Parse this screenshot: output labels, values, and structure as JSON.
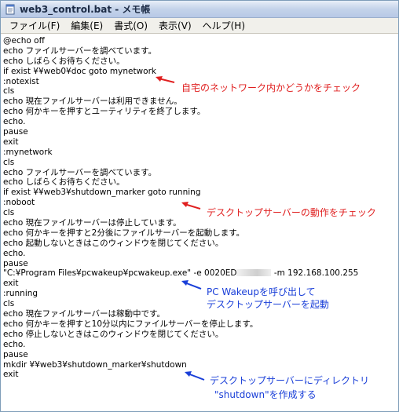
{
  "window": {
    "title": "web3_control.bat - メモ帳"
  },
  "menu": [
    "ファイル(F)",
    "編集(E)",
    "書式(O)",
    "表示(V)",
    "ヘルプ(H)"
  ],
  "code_lines": [
    "@echo off",
    "echo ファイルサーバーを調べています。",
    "echo しばらくお待ちください。",
    "if exist ¥¥web0¥doc goto mynetwork",
    ":notexist",
    "cls",
    "echo 現在ファイルサーバーは利用できません。",
    "echo 何かキーを押すとユーティリティを終了します。",
    "echo.",
    "pause",
    "exit",
    ":mynetwork",
    "cls",
    "echo ファイルサーバーを調べています。",
    "echo しばらくお待ちください。",
    "if exist ¥¥web3¥shutdown_marker goto running",
    ":noboot",
    "cls",
    "echo 現在ファイルサーバーは停止しています。",
    "echo 何かキーを押すと2分後にファイルサーバーを起動します。",
    "echo 起動しないときはこのウィンドウを閉じてください。",
    "echo.",
    "pause",
    "\"C:¥Program Files¥pcwakeup¥pcwakeup.exe\" -e 0020ED",
    "exit",
    ":running",
    "cls",
    "echo 現在ファイルサーバーは稼動中です。",
    "echo 何かキーを押すと10分以内にファイルサーバーを停止します。",
    "echo 停止しないときはこのウィンドウを閉じてください。",
    "echo.",
    "pause",
    "mkdir ¥¥web3¥shutdown_marker¥shutdown",
    "exit"
  ],
  "wakeup_line_suffix": " -m 192.168.100.255",
  "annotations": {
    "check_home_network": "自宅のネットワーク内かどうかをチェック",
    "check_desktop_server": "デスクトップサーバーの動作をチェック",
    "wakeup_line1": "PC Wakeupを呼び出して",
    "wakeup_line2": "デスクトップサーバーを起動",
    "mkdir_line1": "デスクトップサーバーにディレクトリ",
    "mkdir_line2": "\"shutdown\"を作成する"
  },
  "colors": {
    "annotation_red": "#e02020",
    "annotation_blue": "#1a3fd8"
  },
  "icons": {
    "title_icon": "notepad-icon"
  }
}
